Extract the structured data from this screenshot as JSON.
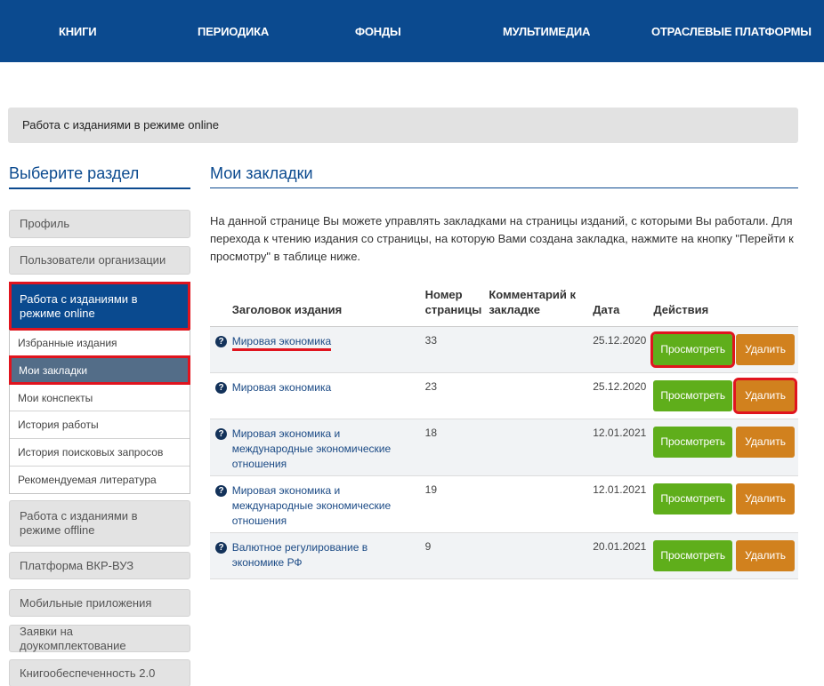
{
  "topnav": [
    "КНИГИ",
    "ПЕРИОДИКА",
    "ФОНДЫ",
    "МУЛЬТИМЕДИА",
    "ОТРАСЛЕВЫЕ ПЛАТФОРМЫ"
  ],
  "breadcrumb": "Работа с изданиями в режиме online",
  "sidebar": {
    "heading": "Выберите раздел",
    "top_items": [
      "Профиль",
      "Пользователи организации"
    ],
    "active_item": "Работа с изданиями в режиме online",
    "sub_items": [
      "Избранные издания",
      "Мои закладки",
      "Мои конспекты",
      "История работы",
      "История поисковых запросов",
      "Рекомендуемая литература"
    ],
    "bottom_items": [
      "Работа с изданиями в режиме offline",
      "Платформа ВКР-ВУЗ",
      "Мобильные приложения",
      "Заявки на доукомплектование",
      "Книгообеспеченность 2.0"
    ]
  },
  "main": {
    "heading": "Мои закладки",
    "intro": "На данной странице Вы можете управлять закладками на страницы изданий, с которыми Вы работали. Для перехода к чтению издания со страницы, на которую Вами создана закладка, нажмите на кнопку \"Перейти к просмотру\" в таблице ниже.",
    "columns": [
      "Заголовок издания",
      "Номер страницы",
      "Комментарий к закладке",
      "Дата",
      "Действия"
    ],
    "view_label": "Просмотреть",
    "delete_label": "Удалить",
    "rows": [
      {
        "title": "Мировая экономика",
        "page": "33",
        "comment": "",
        "date": "25.12.2020"
      },
      {
        "title": "Мировая экономика",
        "page": "23",
        "comment": "",
        "date": "25.12.2020"
      },
      {
        "title": "Мировая экономика и международные экономические отношения",
        "page": "18",
        "comment": "",
        "date": "12.01.2021"
      },
      {
        "title": "Мировая экономика и международные экономические отношения",
        "page": "19",
        "comment": "",
        "date": "12.01.2021"
      },
      {
        "title": "Валютное регулирование в экономике РФ",
        "page": "9",
        "comment": "",
        "date": "20.01.2021"
      }
    ]
  },
  "colors": {
    "nav": "#0b4a8f",
    "view_button": "#5fae1b",
    "delete_button": "#d1811e",
    "highlight": "#e0141e"
  },
  "icons": {
    "row_info": "question-circle-icon"
  }
}
